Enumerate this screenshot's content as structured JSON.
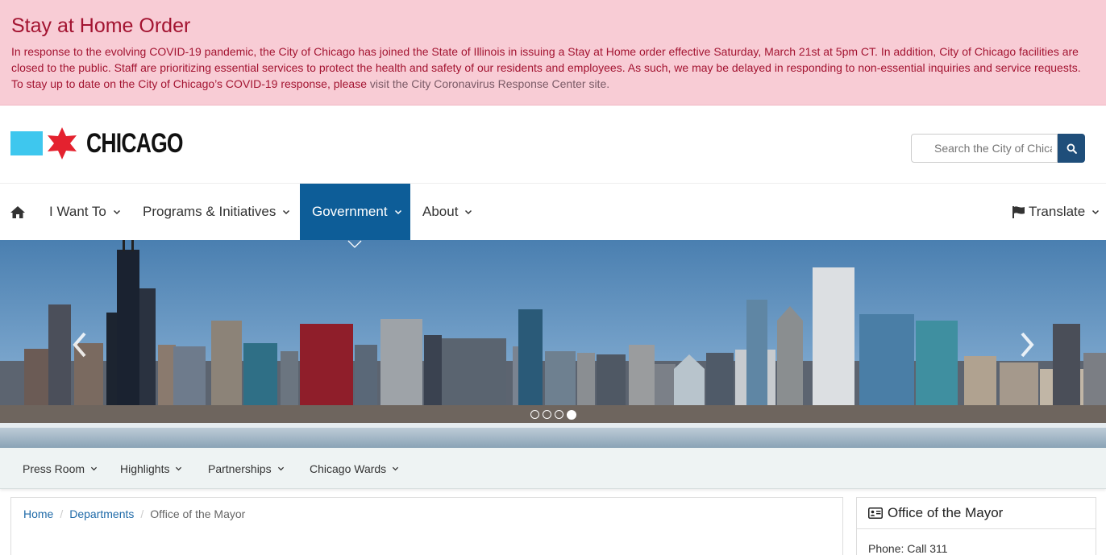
{
  "alert": {
    "title": "Stay at Home Order",
    "body": "In response to the evolving COVID-19 pandemic, the City of Chicago has joined the State of Illinois in issuing a Stay at Home order effective Saturday, March 21st at 5pm CT. In addition, City of Chicago facilities are closed to the public. Staff are prioritizing essential services to protect the health and safety of our residents and employees. As such, we may be delayed in responding to non-essential inquiries and service requests. To stay up to date on the City of Chicago’s COVID-19 response, please ",
    "link_text": "visit the City Coronavirus Response Center site."
  },
  "header": {
    "logo_text": "CHICAGO",
    "search_placeholder": "Search the City of Chicago"
  },
  "nav": {
    "items": [
      {
        "label": "I Want To"
      },
      {
        "label": "Programs & Initiatives"
      },
      {
        "label": "Government",
        "active": true
      },
      {
        "label": "About"
      }
    ],
    "translate_label": "Translate"
  },
  "carousel": {
    "slide_count": 4,
    "active_slide": 4
  },
  "subnav": {
    "items": [
      {
        "label": "Press Room"
      },
      {
        "label": "Highlights"
      },
      {
        "label": "Partnerships"
      },
      {
        "label": "Chicago Wards"
      }
    ]
  },
  "breadcrumb": {
    "items": [
      "Home",
      "Departments"
    ],
    "current": "Office of the Mayor"
  },
  "sidebar": {
    "title": "Office of the Mayor",
    "phone": "Phone: Call 311"
  },
  "colors": {
    "alert_bg": "#f8ccd5",
    "alert_text": "#a31431",
    "nav_active": "#0d5d98",
    "logo_blue": "#3ec7ee",
    "logo_red": "#e4222f"
  }
}
